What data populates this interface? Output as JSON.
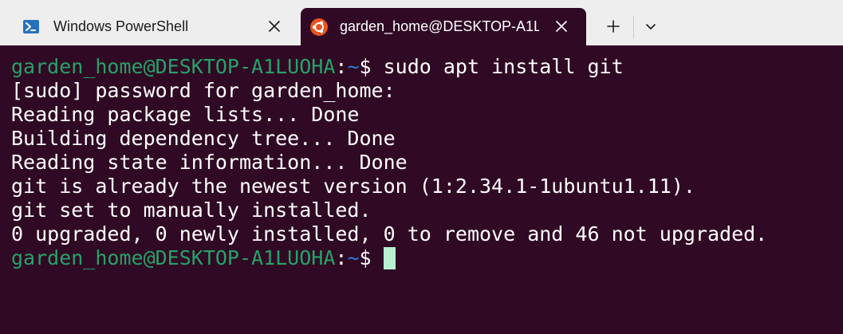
{
  "colors": {
    "tabbar_bg": "#eeeeee",
    "terminal_bg": "#300a24",
    "prompt_user": "#26a269",
    "prompt_path": "#2a7bde",
    "text": "#ffffff",
    "cursor": "#b8f0d2",
    "ubuntu_orange": "#e95420",
    "powershell_blue": "#2671be"
  },
  "tabs": [
    {
      "title": "Windows PowerShell",
      "icon": "powershell-icon",
      "active": false,
      "close_icon": "close-icon"
    },
    {
      "title": "garden_home@DESKTOP-A1L",
      "icon": "ubuntu-icon",
      "active": true,
      "close_icon": "close-icon"
    }
  ],
  "toolbar": {
    "new_tab_icon": "plus-icon",
    "dropdown_icon": "chevron-down-icon"
  },
  "terminal": {
    "prompt": {
      "user_host": "garden_home@DESKTOP-A1LUOHA",
      "separator": ":",
      "path": "~",
      "symbol": "$"
    },
    "command": " sudo apt install git",
    "output": [
      "[sudo] password for garden_home:",
      "Reading package lists... Done",
      "Building dependency tree... Done",
      "Reading state information... Done",
      "git is already the newest version (1:2.34.1-1ubuntu1.11).",
      "git set to manually installed.",
      "0 upgraded, 0 newly installed, 0 to remove and 46 not upgraded."
    ],
    "final_prompt_trailing": " "
  }
}
